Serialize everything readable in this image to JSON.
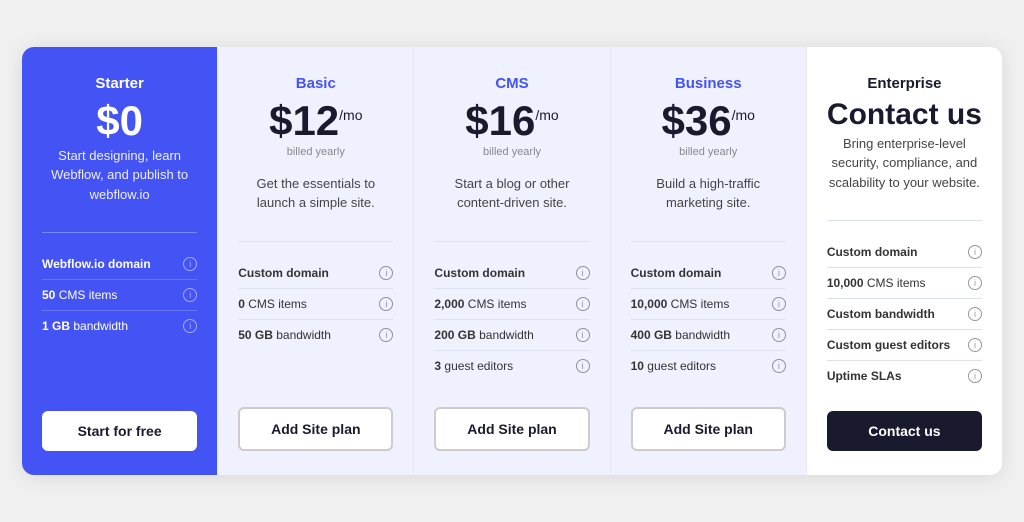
{
  "plans": [
    {
      "id": "starter",
      "name": "Starter",
      "price": "$0",
      "price_suffix": "",
      "billed": "",
      "description": "Start designing, learn Webflow, and publish to webflow.io",
      "features": [
        {
          "label": "Webflow.io domain",
          "highlight": "Webflow.io domain",
          "rest": ""
        },
        {
          "label": "50 CMS items",
          "highlight": "50",
          "rest": " CMS items"
        },
        {
          "label": "1 GB bandwidth",
          "highlight": "1 GB",
          "rest": " bandwidth"
        }
      ],
      "cta_label": "Start for free",
      "cta_type": "white"
    },
    {
      "id": "basic",
      "name": "Basic",
      "price": "$12",
      "price_suffix": "/mo",
      "billed": "billed yearly",
      "description": "Get the essentials to launch a simple site.",
      "features": [
        {
          "label": "Custom domain",
          "highlight": "Custom domain",
          "rest": ""
        },
        {
          "label": "0 CMS items",
          "highlight": "0",
          "rest": " CMS items"
        },
        {
          "label": "50 GB bandwidth",
          "highlight": "50 GB",
          "rest": " bandwidth"
        }
      ],
      "cta_label": "Add Site plan",
      "cta_type": "outline"
    },
    {
      "id": "cms",
      "name": "CMS",
      "price": "$16",
      "price_suffix": "/mo",
      "billed": "billed yearly",
      "description": "Start a blog or other content-driven site.",
      "features": [
        {
          "label": "Custom domain",
          "highlight": "Custom domain",
          "rest": ""
        },
        {
          "label": "2,000 CMS items",
          "highlight": "2,000",
          "rest": " CMS items"
        },
        {
          "label": "200 GB bandwidth",
          "highlight": "200 GB",
          "rest": " bandwidth"
        },
        {
          "label": "3 guest editors",
          "highlight": "3",
          "rest": " guest editors"
        }
      ],
      "cta_label": "Add Site plan",
      "cta_type": "outline"
    },
    {
      "id": "business",
      "name": "Business",
      "price": "$36",
      "price_suffix": "/mo",
      "billed": "billed yearly",
      "description": "Build a high-traffic marketing site.",
      "features": [
        {
          "label": "Custom domain",
          "highlight": "Custom domain",
          "rest": ""
        },
        {
          "label": "10,000 CMS items",
          "highlight": "10,000",
          "rest": " CMS items"
        },
        {
          "label": "400 GB bandwidth",
          "highlight": "400 GB",
          "rest": " bandwidth"
        },
        {
          "label": "10 guest editors",
          "highlight": "10",
          "rest": " guest editors"
        }
      ],
      "cta_label": "Add Site plan",
      "cta_type": "outline"
    },
    {
      "id": "enterprise",
      "name": "Enterprise",
      "price": "Contact us",
      "price_suffix": "",
      "billed": "",
      "description": "Bring enterprise-level security, compliance, and scalability to your website.",
      "features": [
        {
          "label": "Custom domain",
          "highlight": "Custom domain",
          "rest": ""
        },
        {
          "label": "10,000 CMS items",
          "highlight": "10,000",
          "rest": " CMS items"
        },
        {
          "label": "Custom bandwidth",
          "highlight": "Custom bandwidth",
          "rest": ""
        },
        {
          "label": "Custom guest editors",
          "highlight": "Custom guest editors",
          "rest": ""
        },
        {
          "label": "Uptime SLAs",
          "highlight": "Uptime SLAs",
          "rest": ""
        }
      ],
      "cta_label": "Contact us",
      "cta_type": "dark"
    }
  ],
  "icons": {
    "info": "i"
  }
}
